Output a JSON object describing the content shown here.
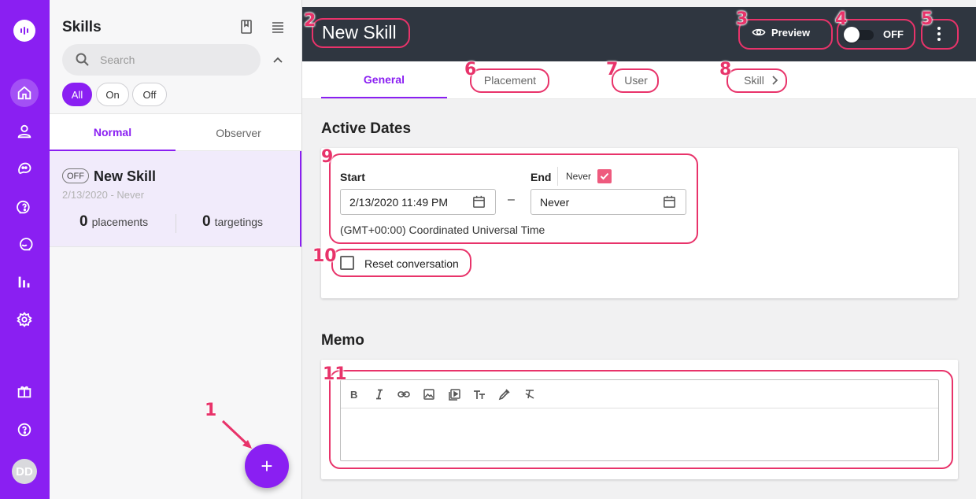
{
  "colors": {
    "brand": "#8a1ff2",
    "annotation": "#e8336a",
    "topbar": "#2f3640",
    "checkbox": "#ee5a7e"
  },
  "rail": {
    "icons": [
      "logo-icon",
      "home-icon",
      "user-icon",
      "chat-icon",
      "help-icon",
      "conversation-icon",
      "analytics-icon",
      "settings-icon",
      "gift-icon",
      "help-circle-icon"
    ],
    "avatar": "DD"
  },
  "skills_panel": {
    "title": "Skills",
    "search_placeholder": "Search",
    "filters": [
      {
        "label": "All",
        "selected": true
      },
      {
        "label": "On",
        "selected": false
      },
      {
        "label": "Off",
        "selected": false
      }
    ],
    "tabs": [
      {
        "label": "Normal",
        "active": true
      },
      {
        "label": "Observer",
        "active": false
      }
    ],
    "items": [
      {
        "status": "OFF",
        "name": "New Skill",
        "date": "2/13/2020 - Never",
        "placements_count": "0",
        "placements_label": "placements",
        "targetings_count": "0",
        "targetings_label": "targetings"
      }
    ],
    "add_button": "+"
  },
  "header": {
    "title": "New Skill",
    "preview_label": "Preview",
    "toggle_label": "OFF",
    "toggle_on": false
  },
  "tabs": [
    {
      "label": "General",
      "active": true
    },
    {
      "label": "Placement",
      "active": false
    },
    {
      "label": "User",
      "active": false
    },
    {
      "label": "Skill",
      "active": false
    }
  ],
  "active_dates": {
    "title": "Active Dates",
    "start_label": "Start",
    "start_value": "2/13/2020 11:49 PM",
    "separator": "–",
    "end_label": "End",
    "never_label": "Never",
    "never_checked": true,
    "end_value": "Never",
    "timezone": "(GMT+00:00) Coordinated Universal Time",
    "reset_label": "Reset conversation",
    "reset_checked": false
  },
  "memo": {
    "title": "Memo",
    "toolbar": [
      "bold-icon",
      "italic-icon",
      "link-icon",
      "image-icon",
      "video-icon",
      "text-size-icon",
      "color-picker-icon",
      "clear-format-icon"
    ],
    "content": ""
  },
  "annotations": [
    "1",
    "2",
    "3",
    "4",
    "5",
    "6",
    "7",
    "8",
    "9",
    "10",
    "11"
  ]
}
